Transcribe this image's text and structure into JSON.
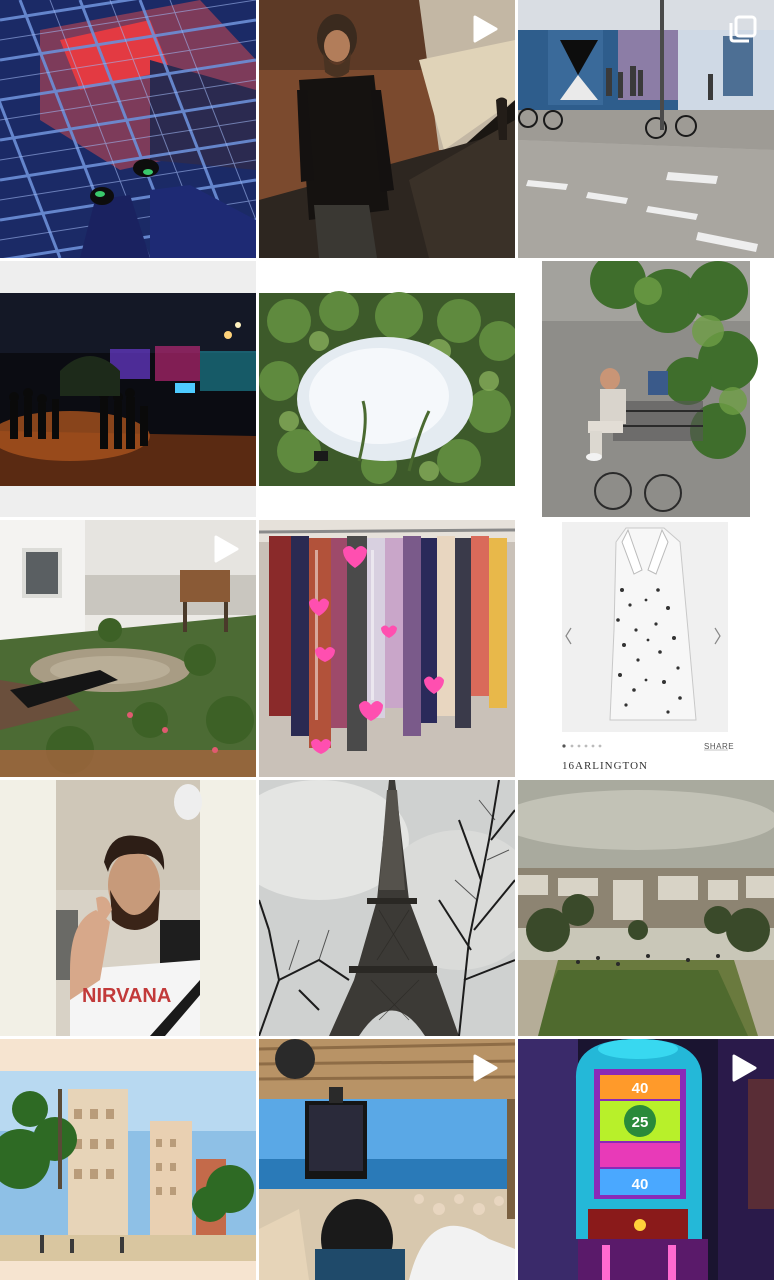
{
  "grid": {
    "columns": 3,
    "rows": 5,
    "background": "#ffffff",
    "tiles": [
      {
        "id": 1,
        "scene": "blue metal grid floor with feet at night",
        "badge": "none"
      },
      {
        "id": 2,
        "scene": "bearded man walking beside a wall at night",
        "badge": "video"
      },
      {
        "id": 3,
        "scene": "street with bicycles beside graffiti wall",
        "badge": "carousel"
      },
      {
        "id": 4,
        "scene": "outdoor party at night with colored lights",
        "badge": "none"
      },
      {
        "id": 5,
        "scene": "bush with white snow center",
        "badge": "none"
      },
      {
        "id": 6,
        "scene": "man sitting on a bench below a tree",
        "badge": "none"
      },
      {
        "id": 7,
        "scene": "garden with bench and white house",
        "badge": "video"
      },
      {
        "id": 8,
        "scene": "clothing rack with colorful garments and pink hearts",
        "badge": "none"
      },
      {
        "id": 9,
        "scene": "spotted white coat product page",
        "badge": "none",
        "brand": "16ARLINGTON",
        "share_label": "SHARE"
      },
      {
        "id": 10,
        "scene": "man with beard giving thumbs up in a car",
        "badge": "none",
        "shirt_text": "NIRVANA"
      },
      {
        "id": 11,
        "scene": "Eiffel tower with bare trees",
        "badge": "none"
      },
      {
        "id": 12,
        "scene": "city view from a hill with park",
        "badge": "none"
      },
      {
        "id": 13,
        "scene": "palm trees and buildings on a sunny plaza",
        "badge": "none"
      },
      {
        "id": 14,
        "scene": "beach bar with tv screen and sea",
        "badge": "video"
      },
      {
        "id": 15,
        "scene": "arcade machine with neon lights",
        "badge": "video",
        "machine_numbers": [
          "40",
          "25",
          "40"
        ]
      }
    ]
  },
  "colors": {
    "badge": "#ffffff",
    "heart": "#ff4fb0"
  },
  "icons": {
    "video": "play-icon",
    "carousel": "carousel-icon"
  }
}
